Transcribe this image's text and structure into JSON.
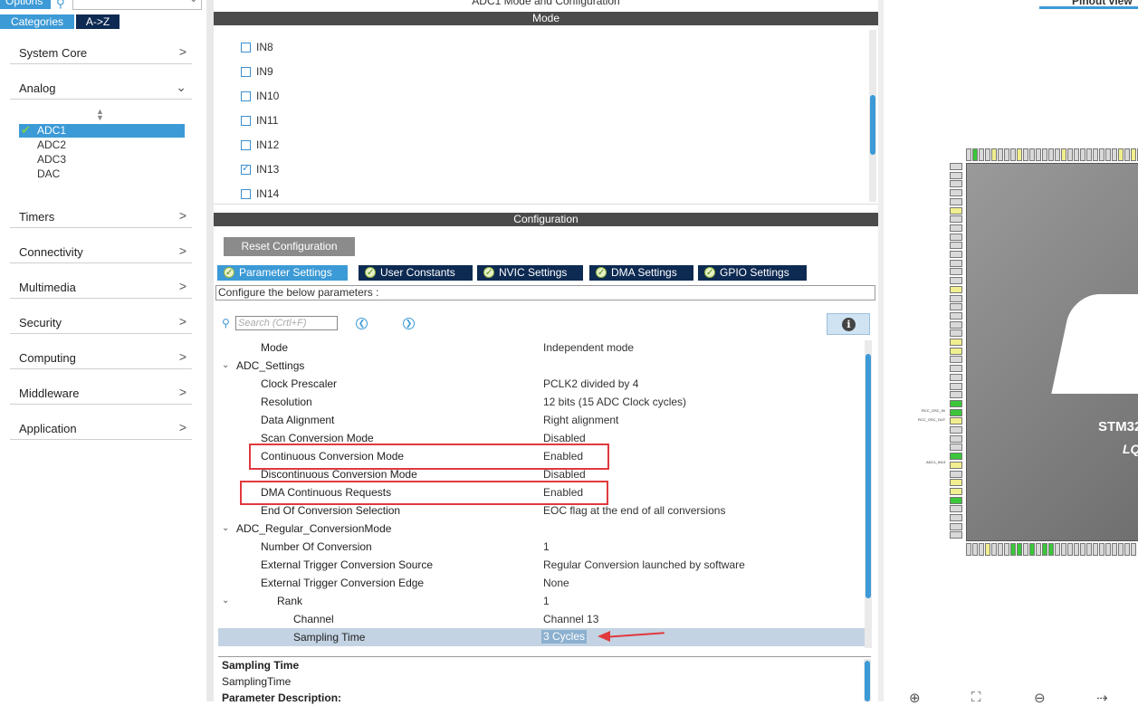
{
  "left": {
    "options_label": "Options",
    "tab_categories": "Categories",
    "tab_az": "A->Z",
    "categories": [
      {
        "label": "System Core",
        "arrow": ">"
      },
      {
        "label": "Analog",
        "arrow": "⌄"
      },
      {
        "label": "Timers",
        "arrow": ">"
      },
      {
        "label": "Connectivity",
        "arrow": ">"
      },
      {
        "label": "Multimedia",
        "arrow": ">"
      },
      {
        "label": "Security",
        "arrow": ">"
      },
      {
        "label": "Computing",
        "arrow": ">"
      },
      {
        "label": "Middleware",
        "arrow": ">"
      },
      {
        "label": "Application",
        "arrow": ">"
      }
    ],
    "analog_items": [
      "ADC1",
      "ADC2",
      "ADC3",
      "DAC"
    ]
  },
  "mid": {
    "top_title": "ADC1 Mode and Configuration",
    "mode_title": "Mode",
    "inputs": [
      {
        "label": "IN8",
        "checked": false
      },
      {
        "label": "IN9",
        "checked": false
      },
      {
        "label": "IN10",
        "checked": false
      },
      {
        "label": "IN11",
        "checked": false
      },
      {
        "label": "IN12",
        "checked": false
      },
      {
        "label": "IN13",
        "checked": true
      },
      {
        "label": "IN14",
        "checked": false
      }
    ],
    "config_title": "Configuration",
    "reset_label": "Reset Configuration",
    "tabs": [
      "Parameter Settings",
      "User Constants",
      "NVIC Settings",
      "DMA Settings",
      "GPIO Settings"
    ],
    "configure_text": "Configure the below parameters :",
    "search_placeholder": "Search (Crtl+F)",
    "params": [
      {
        "name": "Mode",
        "value": "Independent mode",
        "level": 1,
        "group": false
      },
      {
        "name": "ADC_Settings",
        "value": "",
        "level": 0,
        "group": true
      },
      {
        "name": "Clock Prescaler",
        "value": "PCLK2 divided by 4",
        "level": 1,
        "group": false
      },
      {
        "name": "Resolution",
        "value": "12 bits (15 ADC Clock cycles)",
        "level": 1,
        "group": false
      },
      {
        "name": "Data Alignment",
        "value": "Right alignment",
        "level": 1,
        "group": false
      },
      {
        "name": "Scan Conversion Mode",
        "value": "Disabled",
        "level": 1,
        "group": false
      },
      {
        "name": "Continuous Conversion Mode",
        "value": "Enabled",
        "level": 1,
        "group": false
      },
      {
        "name": "Discontinuous Conversion Mode",
        "value": "Disabled",
        "level": 1,
        "group": false
      },
      {
        "name": "DMA Continuous Requests",
        "value": "Enabled",
        "level": 1,
        "group": false
      },
      {
        "name": "End Of Conversion Selection",
        "value": "EOC flag at the end of all conversions",
        "level": 1,
        "group": false
      },
      {
        "name": "ADC_Regular_ConversionMode",
        "value": "",
        "level": 0,
        "group": true
      },
      {
        "name": "Number Of Conversion",
        "value": "1",
        "level": 1,
        "group": false
      },
      {
        "name": "External Trigger Conversion Source",
        "value": "Regular Conversion launched by software",
        "level": 1,
        "group": false
      },
      {
        "name": "External Trigger Conversion Edge",
        "value": "None",
        "level": 1,
        "group": false
      },
      {
        "name": "Rank",
        "value": "1",
        "level": 2,
        "group": true
      },
      {
        "name": "Channel",
        "value": "Channel 13",
        "level": 3,
        "group": false
      },
      {
        "name": "Sampling Time",
        "value": "3 Cycles",
        "level": 3,
        "group": false,
        "selected": true
      }
    ],
    "desc": [
      "Sampling Time",
      "SamplingTime",
      "Parameter Description:"
    ]
  },
  "right": {
    "pinout_tab": "Pinout view",
    "chip_name": "STM32",
    "chip_pkg": "LQ",
    "pin_labels": [
      "RCC_OSC_IN",
      "RCC_OSC_OUT",
      "ADC1_IN13"
    ]
  },
  "colors": {
    "accent": "#3c9ad6",
    "dark_tab": "#0d2a52",
    "highlight": "#e0393e"
  }
}
